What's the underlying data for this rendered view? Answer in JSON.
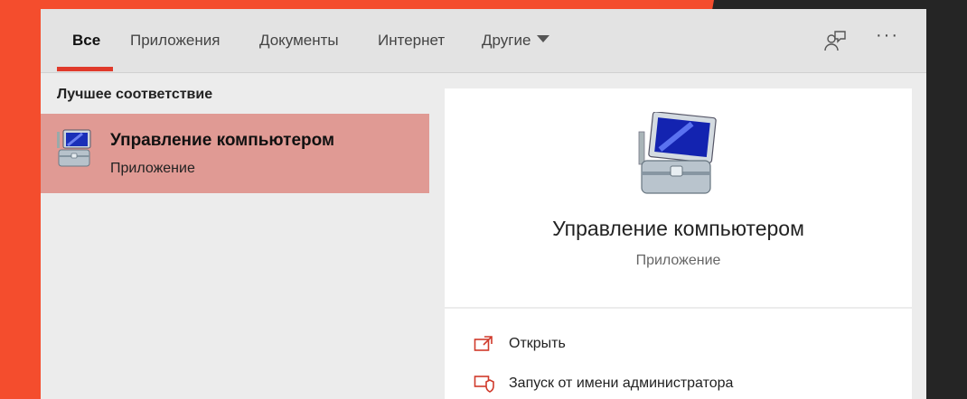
{
  "tabs": [
    {
      "label": "Все",
      "active": true
    },
    {
      "label": "Приложения"
    },
    {
      "label": "Документы"
    },
    {
      "label": "Интернет"
    },
    {
      "label": "Другие"
    }
  ],
  "header_icons": [
    "feedback-icon",
    "more-options-icon"
  ],
  "more_label": "···",
  "best_match": {
    "heading": "Лучшее соответствие",
    "title": "Управление компьютером",
    "subtitle": "Приложение",
    "icon": "computer-management-icon"
  },
  "detail": {
    "title": "Управление компьютером",
    "subtitle": "Приложение",
    "actions": [
      {
        "label": "Открыть",
        "icon": "open-icon"
      },
      {
        "label": "Запуск от имени администратора",
        "icon": "run-as-admin-icon"
      }
    ]
  },
  "colors": {
    "accent": "#e03a2b",
    "selected_bg": "#e09a94",
    "background": "#f44d2d"
  }
}
